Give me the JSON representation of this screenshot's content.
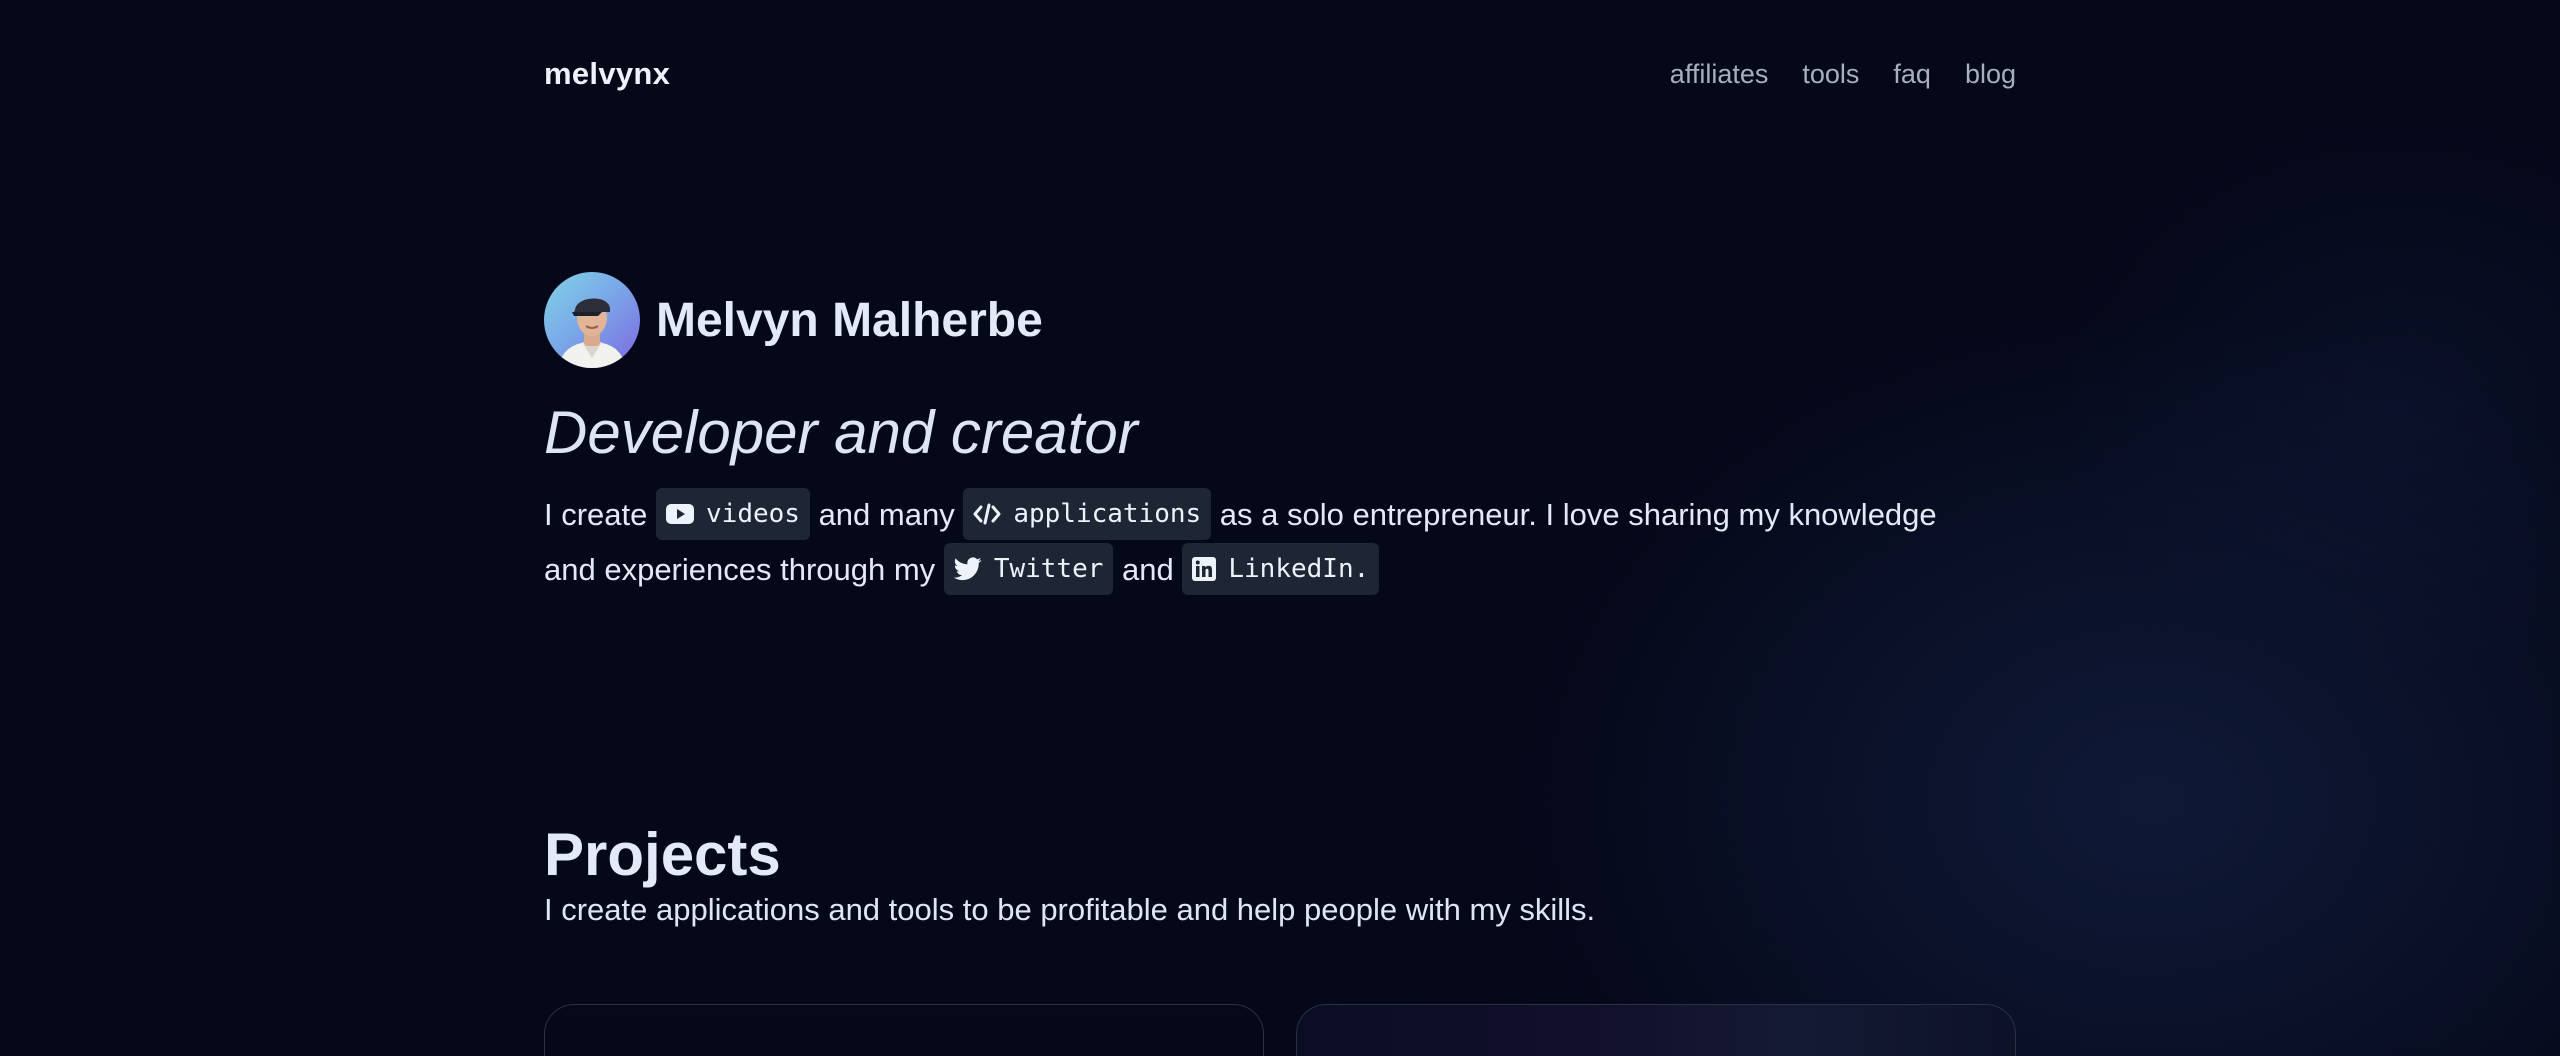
{
  "header": {
    "brand": "melvynx",
    "nav": [
      "affiliates",
      "tools",
      "faq",
      "blog"
    ]
  },
  "hero": {
    "name": "Melvyn Malherbe",
    "tagline": "Developer and creator",
    "text": {
      "part1": "I create",
      "videos_chip": "videos",
      "part2": "and many",
      "applications_chip": "applications",
      "part3": "as a solo entrepreneur. I love sharing my knowledge and experiences through my",
      "twitter_chip": "Twitter",
      "part4": "and",
      "linkedin_chip": "LinkedIn."
    }
  },
  "projects": {
    "title": "Projects",
    "subtitle": "I create applications and tools to be profitable and help people with my skills."
  },
  "icons": {
    "videos": "youtube-icon",
    "applications": "code-icon",
    "twitter": "twitter-icon",
    "linkedin": "linkedin-icon"
  },
  "colors": {
    "background": "#050819",
    "chip_background": "#1e2535",
    "text_primary": "#e3e9f7",
    "nav_text": "#a8aebd"
  }
}
